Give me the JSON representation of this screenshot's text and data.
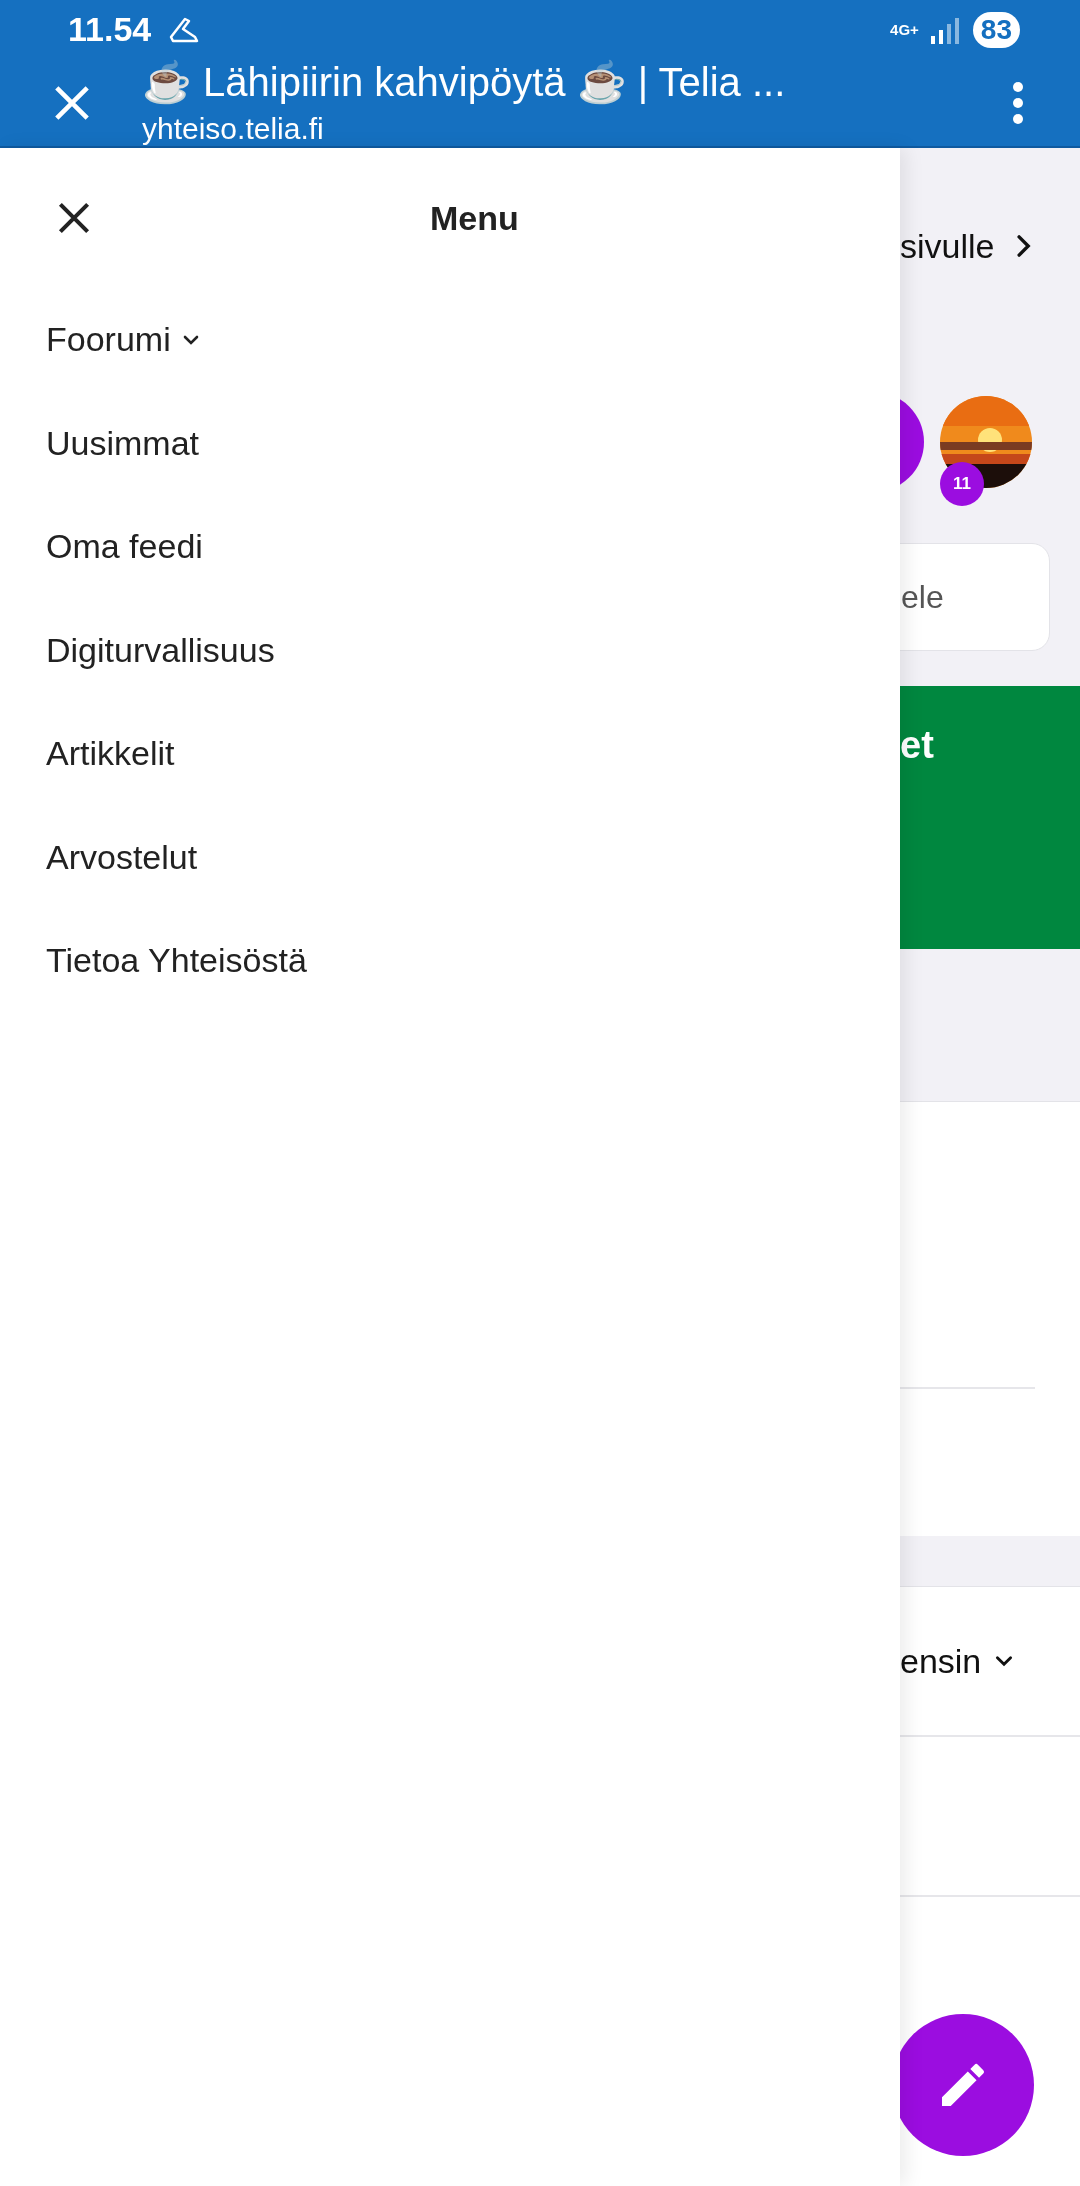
{
  "status_bar": {
    "time": "11.54",
    "network": "4G+",
    "battery": "83"
  },
  "browser_bar": {
    "title": "☕ Lähipiirin kahvipöytä ☕ | Telia ...",
    "url": "yhteiso.telia.fi"
  },
  "menu": {
    "title": "Menu",
    "items": [
      {
        "label": "Foorumi",
        "kind": "dropdown"
      },
      {
        "label": "Uusimmat",
        "kind": "link"
      },
      {
        "label": "Oma feedi",
        "kind": "link"
      },
      {
        "label": "Digiturvallisuus",
        "kind": "link"
      },
      {
        "label": "Artikkelit",
        "kind": "link"
      },
      {
        "label": "Arvostelut",
        "kind": "link"
      },
      {
        "label": "Tietoa Yhteisöstä",
        "kind": "link"
      }
    ]
  },
  "page": {
    "back_link": "sivulle",
    "avatar_badge": "11",
    "search": {
      "placeholder": "ele"
    },
    "banner": "et",
    "sort": "ensin"
  }
}
